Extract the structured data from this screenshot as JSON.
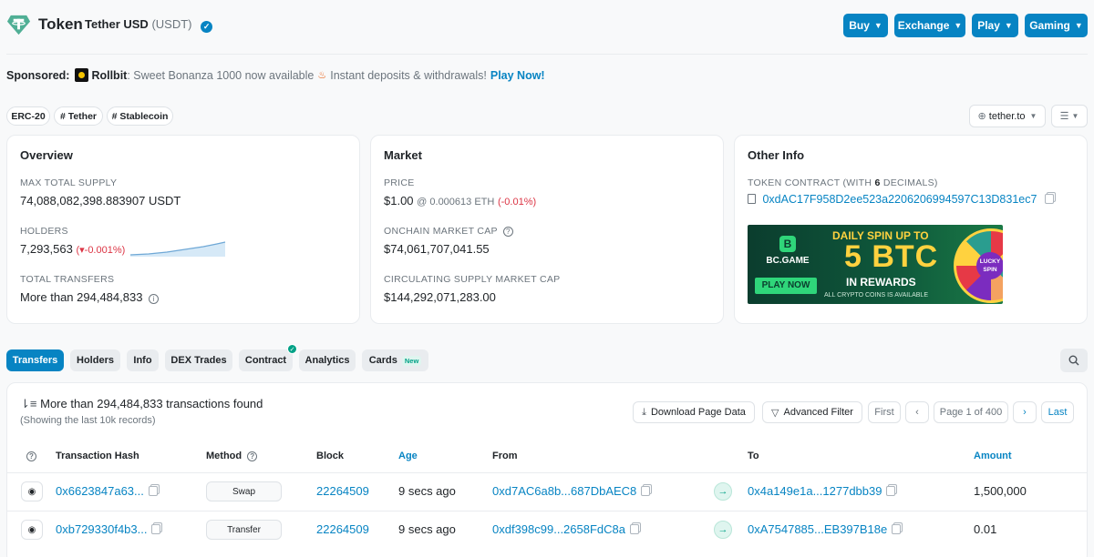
{
  "header": {
    "title": "Token",
    "token_name": "Tether USD",
    "token_symbol": "(USDT)",
    "buttons": [
      {
        "label": "Buy"
      },
      {
        "label": "Exchange"
      },
      {
        "label": "Play"
      },
      {
        "label": "Gaming"
      }
    ]
  },
  "sponsored": {
    "label": "Sponsored:",
    "brand": "Rollbit",
    "text": ": Sweet Bonanza 1000 now available",
    "text2": "Instant deposits & withdrawals!",
    "cta": "Play Now!"
  },
  "tags": [
    "ERC-20",
    "# Tether",
    "# Stablecoin"
  ],
  "site_link": "tether.to",
  "overview": {
    "title": "Overview",
    "max_supply_label": "MAX TOTAL SUPPLY",
    "max_supply_value": "74,088,082,398.883907 USDT",
    "holders_label": "HOLDERS",
    "holders_value": "7,293,563",
    "holders_change": "(▾-0.001%)",
    "transfers_label": "TOTAL TRANSFERS",
    "transfers_value": "More than 294,484,833"
  },
  "market": {
    "title": "Market",
    "price_label": "PRICE",
    "price_value": "$1.00",
    "price_eth": "@ 0.000613 ETH",
    "price_change": "(-0.01%)",
    "onchain_label": "ONCHAIN MARKET CAP",
    "onchain_value": "$74,061,707,041.55",
    "circ_label": "CIRCULATING SUPPLY MARKET CAP",
    "circ_value": "$144,292,071,283.00"
  },
  "other_info": {
    "title": "Other Info",
    "contract_label_pre": "TOKEN CONTRACT (WITH ",
    "contract_decimals": "6",
    "contract_label_post": " DECIMALS)",
    "contract_address": "0xdAC17F958D2ee523a2206206994597C13D831ec7"
  },
  "banner": {
    "brand": "BC.GAME",
    "line1": "DAILY SPIN UP TO",
    "line2": "5 BTC",
    "line3": "IN REWARDS",
    "line4": "ALL CRYPTO COINS IS AVAILABLE",
    "cta": "PLAY NOW",
    "wheel": "LUCKY SPIN"
  },
  "tabs": [
    {
      "label": "Transfers",
      "active": true
    },
    {
      "label": "Holders"
    },
    {
      "label": "Info"
    },
    {
      "label": "DEX Trades"
    },
    {
      "label": "Contract"
    },
    {
      "label": "Analytics"
    },
    {
      "label": "Cards",
      "badge": "New"
    }
  ],
  "results": {
    "summary": "More than 294,484,833 transactions found",
    "sub": "(Showing the last 10k records)",
    "download": "Download Page Data",
    "filter": "Advanced Filter",
    "first": "First",
    "page": "Page 1 of 400",
    "last": "Last"
  },
  "table": {
    "headers": [
      "Transaction Hash",
      "Method",
      "Block",
      "Age",
      "From",
      "To",
      "Amount"
    ],
    "rows": [
      {
        "hash": "0x6623847a63...",
        "method": "Swap",
        "block": "22264509",
        "age": "9 secs ago",
        "from": "0xd7AC6a8b...687DbAEC8",
        "to": "0x4a149e1a...1277dbb39",
        "amount": "1,500,000"
      },
      {
        "hash": "0xb729330f4b3...",
        "method": "Transfer",
        "block": "22264509",
        "age": "9 secs ago",
        "from": "0xdf398c99...2658FdC8a",
        "to": "0xA7547885...EB397B18e",
        "amount": "0.01"
      }
    ]
  },
  "colors": {
    "primary": "#0784c3",
    "negative": "#dc3545",
    "success": "#00a186"
  },
  "icons": {
    "logo": "tether-logo-icon",
    "verified": "verified-check-icon",
    "copy": "copy-icon",
    "search": "search-icon",
    "eye": "eye-icon",
    "arrow": "arrow-right-icon"
  }
}
